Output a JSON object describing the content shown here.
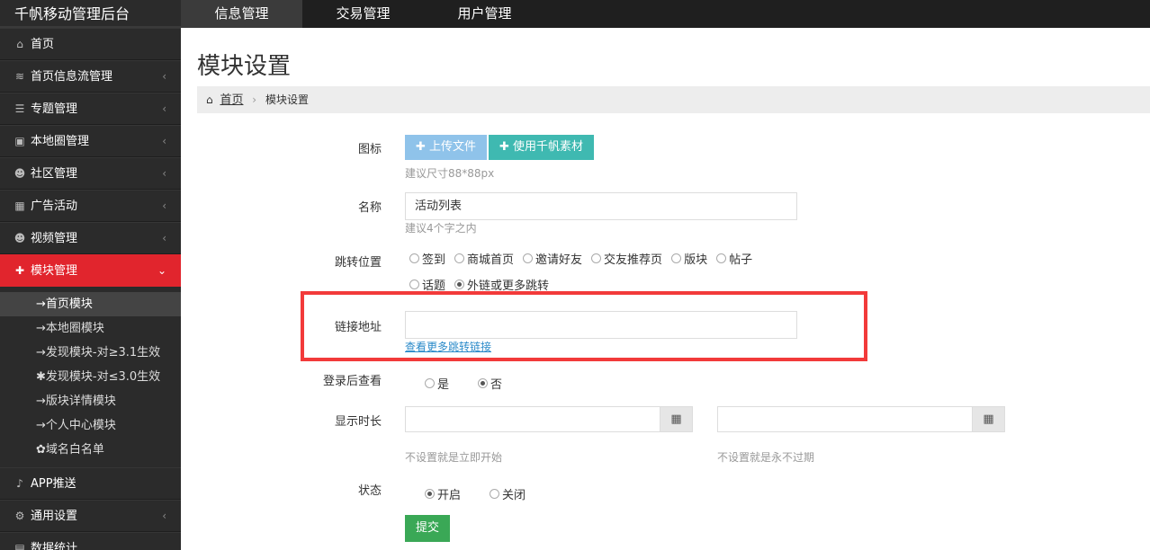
{
  "brand": "千帆移动管理后台",
  "top_tabs": [
    {
      "label": "信息管理"
    },
    {
      "label": "交易管理"
    },
    {
      "label": "用户管理"
    }
  ],
  "sidebar": {
    "items": [
      {
        "label": "首页",
        "icon": "home-icon"
      },
      {
        "label": "首页信息流管理",
        "icon": "rss-icon"
      },
      {
        "label": "专题管理",
        "icon": "list-icon"
      },
      {
        "label": "本地圈管理",
        "icon": "image-icon"
      },
      {
        "label": "社区管理",
        "icon": "users-icon"
      },
      {
        "label": "广告活动",
        "icon": "calendar-icon"
      },
      {
        "label": "视频管理",
        "icon": "users-icon"
      },
      {
        "label": "模块管理",
        "icon": "puzzle-icon"
      },
      {
        "label": "APP推送",
        "icon": "bell-icon"
      },
      {
        "label": "通用设置",
        "icon": "cogs-icon"
      },
      {
        "label": "数据统计",
        "icon": "chart-icon"
      }
    ],
    "submenu": [
      {
        "label": "首页模块"
      },
      {
        "label": "本地圈模块"
      },
      {
        "label": "发现模块-对≥3.1生效"
      },
      {
        "label": "发现模块-对≤3.0生效"
      },
      {
        "label": "版块详情模块"
      },
      {
        "label": "个人中心模块"
      },
      {
        "label": "域名白名单"
      }
    ]
  },
  "page": {
    "title": "模块设置",
    "breadcrumb": {
      "home": "首页",
      "current": "模块设置"
    }
  },
  "form": {
    "icon_label": "图标",
    "upload_btn": "上传文件",
    "material_btn": "使用千帆素材",
    "icon_help": "建议尺寸88*88px",
    "name_label": "名称",
    "name_value": "活动列表",
    "name_help": "建议4个字之内",
    "jump_label": "跳转位置",
    "jump_options": [
      "签到",
      "商城首页",
      "邀请好友",
      "交友推荐页",
      "版块",
      "帖子",
      "话题",
      "外链或更多跳转"
    ],
    "link_label": "链接地址",
    "link_value": "",
    "link_more": "查看更多跳转链接",
    "login_label": "登录后查看",
    "login_yes": "是",
    "login_no": "否",
    "duration_label": "显示时长",
    "start_help": "不设置就是立即开始",
    "end_help": "不设置就是永不过期",
    "status_label": "状态",
    "status_on": "开启",
    "status_off": "关闭",
    "submit": "提交"
  }
}
